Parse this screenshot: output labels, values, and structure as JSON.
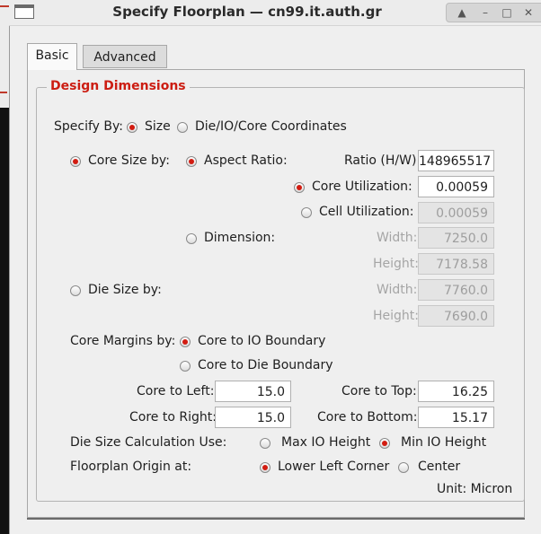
{
  "window": {
    "title": "Specify Floorplan — cn99.it.auth.gr",
    "controls": [
      "up-arrow-icon",
      "minimize-icon",
      "maximize-icon",
      "close-icon"
    ]
  },
  "tabs": [
    {
      "label": "Basic",
      "selected": true
    },
    {
      "label": "Advanced",
      "selected": false
    }
  ],
  "group": {
    "title": "Design Dimensions"
  },
  "specify_by": {
    "label": "Specify By:",
    "options": [
      {
        "label": "Size",
        "selected": true
      },
      {
        "label": "Die/IO/Core Coordinates",
        "selected": false
      }
    ]
  },
  "core_size": {
    "label": "Core Size by:",
    "selected": true,
    "aspect_ratio": {
      "label": "Aspect Ratio:",
      "selected": true
    },
    "ratio": {
      "label": "Ratio (H/W):",
      "value": "148965517"
    },
    "core_utilization": {
      "label": "Core Utilization:",
      "selected": true,
      "value": "0.00059"
    },
    "cell_utilization": {
      "label": "Cell Utilization:",
      "selected": false,
      "value": "0.00059"
    },
    "dimension": {
      "label": "Dimension:",
      "selected": false
    },
    "width": {
      "label": "Width:",
      "value": "7250.0"
    },
    "height": {
      "label": "Height:",
      "value": "7178.58"
    }
  },
  "die_size": {
    "label": "Die Size by:",
    "selected": false,
    "width": {
      "label": "Width:",
      "value": "7760.0"
    },
    "height": {
      "label": "Height:",
      "value": "7690.0"
    }
  },
  "core_margins": {
    "label": "Core Margins by:",
    "options": [
      {
        "label": "Core to IO Boundary",
        "selected": true
      },
      {
        "label": "Core to Die Boundary",
        "selected": false
      }
    ]
  },
  "margins": {
    "left": {
      "label": "Core to Left:",
      "value": "15.0"
    },
    "top": {
      "label": "Core to Top:",
      "value": "16.25"
    },
    "right": {
      "label": "Core to Right:",
      "value": "15.0"
    },
    "bottom": {
      "label": "Core to Bottom:",
      "value": "15.17"
    }
  },
  "die_calc": {
    "label": "Die Size Calculation Use:",
    "options": [
      {
        "label": "Max IO Height",
        "selected": false
      },
      {
        "label": "Min IO Height",
        "selected": true
      }
    ]
  },
  "origin": {
    "label": "Floorplan Origin at:",
    "options": [
      {
        "label": "Lower Left Corner",
        "selected": true
      },
      {
        "label": "Center",
        "selected": false
      }
    ]
  },
  "unit": "Unit: Micron",
  "colors": {
    "accent": "#cc1d12",
    "radio_selected": "#d21c11"
  }
}
